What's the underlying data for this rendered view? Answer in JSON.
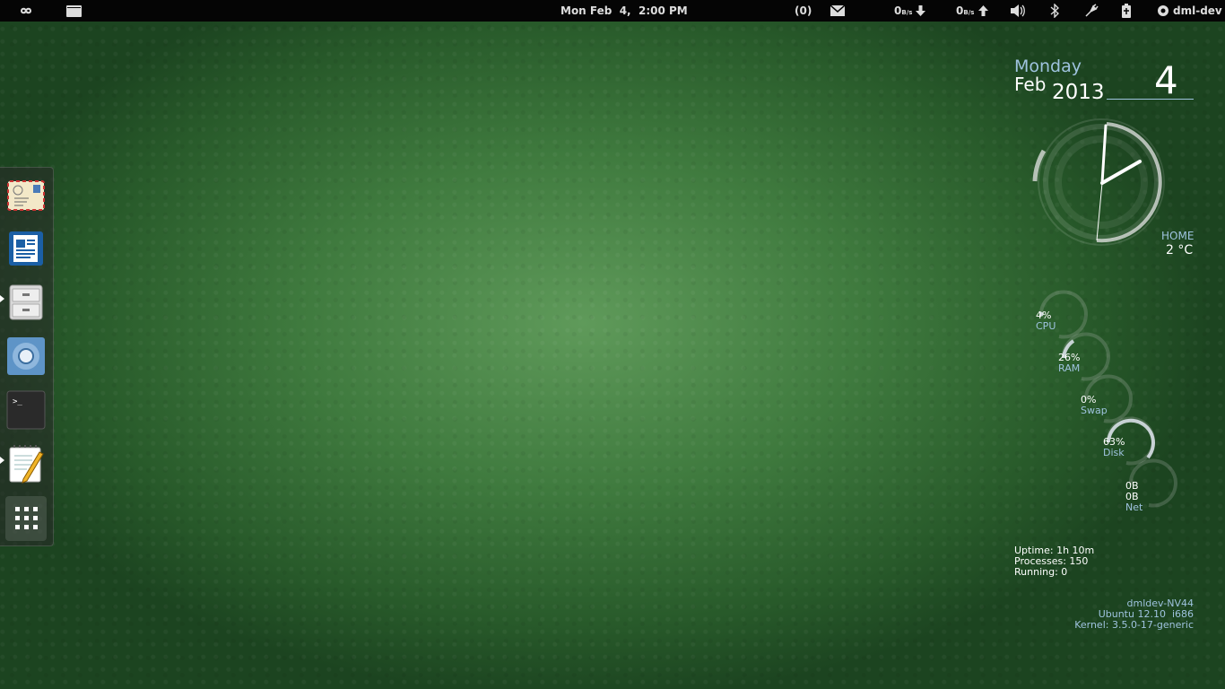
{
  "topbar": {
    "datetime": "Mon Feb  4,  2:00 PM",
    "mail_count": "(0)",
    "net_down": "0",
    "net_down_unit": "B/s",
    "net_up": "0",
    "net_up_unit": "B/s",
    "username": "dml-dev"
  },
  "dock": {
    "items": [
      {
        "name": "mail-app-icon",
        "running": false
      },
      {
        "name": "writer-app-icon",
        "running": false
      },
      {
        "name": "files-app-icon",
        "running": true
      },
      {
        "name": "chromium-app-icon",
        "running": false
      },
      {
        "name": "terminal-app-icon",
        "running": false
      },
      {
        "name": "text-editor-app-icon",
        "running": true
      },
      {
        "name": "apps-grid-icon",
        "running": false
      }
    ]
  },
  "conky": {
    "day": "Monday",
    "month": "Feb",
    "year": "2013",
    "date": "4",
    "weather_location": "HOME",
    "weather_temp": "2 °C",
    "gauges": [
      {
        "value": "4%",
        "label": "CPU",
        "fraction": 0.04
      },
      {
        "value": "26%",
        "label": "RAM",
        "fraction": 0.26
      },
      {
        "value": "0%",
        "label": "Swap",
        "fraction": 0.0
      },
      {
        "value": "63%",
        "label": "Disk",
        "fraction": 0.63
      }
    ],
    "net": {
      "down": "0B",
      "up": "0B",
      "label": "Net"
    },
    "uptime": "Uptime: 1h 10m",
    "processes": "Processes: 150",
    "running": "Running: 0",
    "hostname": "dmldev-NV44",
    "os": "Ubuntu 12.10  i686",
    "kernel": "Kernel: 3.5.0-17-generic"
  },
  "colors": {
    "accent": "#9fc3df",
    "panel": "#050505"
  }
}
